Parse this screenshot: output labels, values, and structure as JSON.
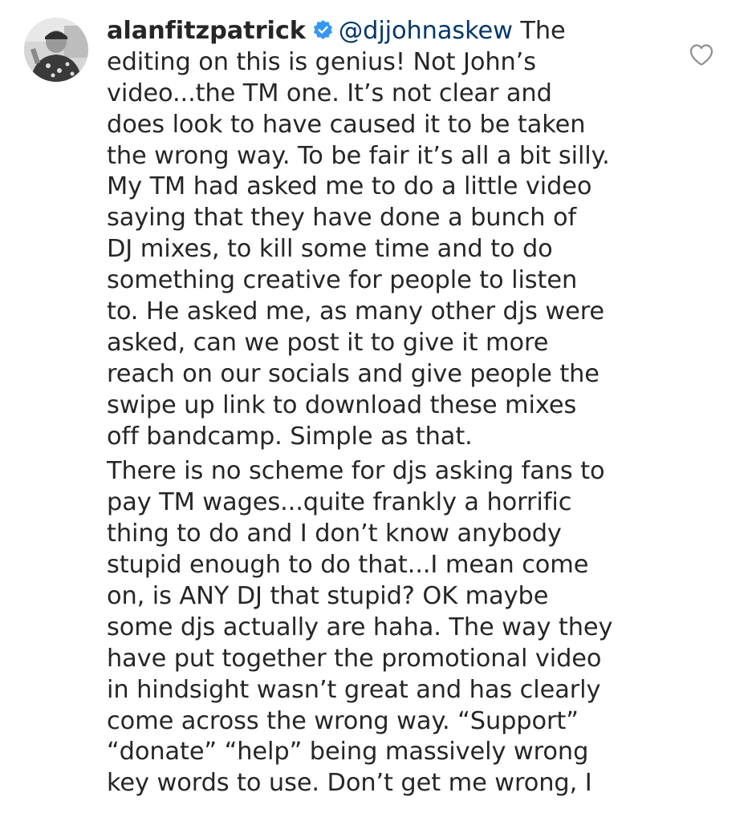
{
  "comment": {
    "username": "alanfitzpatrick",
    "verified": true,
    "mention": "@djjohnaskew",
    "first_line_rest": " The",
    "paragraph1": [
      "editing on this is genius! Not John’s",
      "video...the TM one. It’s not clear and",
      "does look to have caused it to be taken",
      "the wrong way. To be fair it’s all a bit silly.",
      "My TM had asked me to do a little video",
      "saying that they have done a bunch of",
      "DJ mixes, to kill some time and to do",
      "something creative for people to listen",
      "to. He asked me, as many other djs were",
      "asked, can we post it to give it more",
      "reach on our socials and give people the",
      "swipe up link to download these mixes",
      "off bandcamp. Simple as that."
    ],
    "paragraph2": [
      "There is no scheme for djs asking fans to",
      "pay TM wages...quite frankly a horrific",
      "thing to do and I don’t know anybody",
      "stupid enough to do that...I mean come",
      "on, is ANY DJ that stupid? OK maybe",
      "some djs actually are haha. The way they",
      "have put together the promotional video",
      "in hindsight wasn’t great and has clearly",
      "come across the wrong way. “Support”",
      "“donate” “help” being massively wrong",
      "key words to use. Don’t get me wrong, I"
    ]
  },
  "icons": {
    "avatar": "profile-photo",
    "verified": "verified-badge-icon",
    "like": "heart-outline-icon"
  },
  "colors": {
    "text": "#262626",
    "mention": "#00376b",
    "verified": "#3897f0",
    "icon_stroke": "#8e8e8e"
  }
}
